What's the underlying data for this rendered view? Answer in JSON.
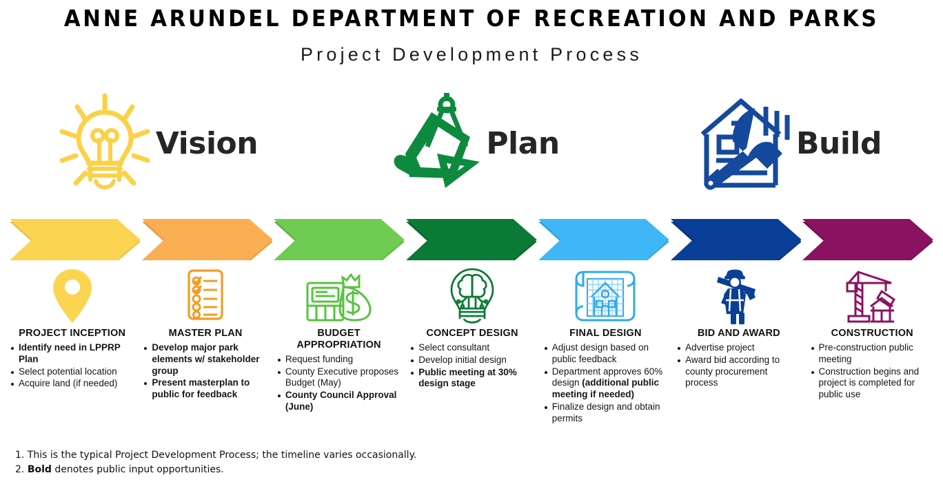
{
  "header": {
    "title": "ANNE ARUNDEL DEPARTMENT OF RECREATION AND PARKS",
    "subtitle": "Project Development Process"
  },
  "phases": [
    {
      "label": "Vision",
      "icon": "lightbulb-rays-icon",
      "color": "#FBD148"
    },
    {
      "label": "Plan",
      "icon": "blueprint-compass-icon",
      "color": "#0E8A3E"
    },
    {
      "label": "Build",
      "icon": "house-hammer-icon",
      "color": "#14499E"
    }
  ],
  "chevrons": [
    {
      "name": "chevron-project-inception",
      "color": "#FBD451",
      "shadow": "#E9C03F"
    },
    {
      "name": "chevron-master-plan",
      "color": "#F9AE52",
      "shadow": "#E89B40"
    },
    {
      "name": "chevron-budget-appropriation",
      "color": "#6FCB52",
      "shadow": "#5DB743"
    },
    {
      "name": "chevron-concept-design",
      "color": "#0B7A36",
      "shadow": "#09662D"
    },
    {
      "name": "chevron-final-design",
      "color": "#3FB7F7",
      "shadow": "#2FA3E3"
    },
    {
      "name": "chevron-bid-and-award",
      "color": "#0A3F97",
      "shadow": "#083383"
    },
    {
      "name": "chevron-construction",
      "color": "#8B1260",
      "shadow": "#760C51"
    }
  ],
  "steps": [
    {
      "title": "PROJECT INCEPTION",
      "icon": "map-pin-icon",
      "color": "#FBD451",
      "items": [
        {
          "text": "Identify need in LPPRP Plan",
          "bold": true
        },
        {
          "text": "Select potential location",
          "bold": false
        },
        {
          "text": "Acquire land (if needed)",
          "bold": false
        }
      ]
    },
    {
      "title": "MASTER PLAN",
      "icon": "checklist-icon",
      "color": "#F39C22",
      "items": [
        {
          "text": "Develop major park elements w/ stakeholder group",
          "bold": true
        },
        {
          "text": "Present masterplan to public for feedback",
          "bold": true
        }
      ]
    },
    {
      "title": "BUDGET APPROPRIATION",
      "icon": "money-bag-ledger-icon",
      "color": "#57C33F",
      "items": [
        {
          "text": "Request funding",
          "bold": false
        },
        {
          "text": "County Executive proposes Budget (May)",
          "bold": false
        },
        {
          "text": "County Council Approval (June)",
          "bold": true
        }
      ]
    },
    {
      "title": "CONCEPT DESIGN",
      "icon": "brain-bulb-icon",
      "color": "#0B7A36",
      "items": [
        {
          "text": "Select consultant",
          "bold": false
        },
        {
          "text": "Develop initial design",
          "bold": false
        },
        {
          "text": "Public meeting at 30% design stage",
          "bold": true
        }
      ]
    },
    {
      "title": "FINAL DESIGN",
      "icon": "blueprint-scroll-icon",
      "color": "#2FA8F2",
      "items": [
        {
          "text": "Adjust design based on public feedback",
          "bold": false
        },
        {
          "html": "Department approves 60% design <b>(additional public meeting if needed)</b>",
          "bold": false
        },
        {
          "text": "Finalize design and obtain permits",
          "bold": false
        }
      ]
    },
    {
      "title": "BID AND AWARD",
      "icon": "construction-worker-icon",
      "color": "#0A3F97",
      "items": [
        {
          "text": "Advertise project",
          "bold": false
        },
        {
          "text": "Award bid according to county procurement process",
          "bold": false
        }
      ]
    },
    {
      "title": "CONSTRUCTION",
      "icon": "crane-building-icon",
      "color": "#8B1260",
      "items": [
        {
          "text": "Pre-construction public meeting",
          "bold": false
        },
        {
          "text": "Construction begins and project is completed for public use",
          "bold": false
        }
      ]
    }
  ],
  "footnotes": [
    {
      "html": "1. This is the typical Project Development Process; the timeline varies occasionally."
    },
    {
      "html": "2. <b>Bold</b> denotes public input opportunities."
    }
  ]
}
